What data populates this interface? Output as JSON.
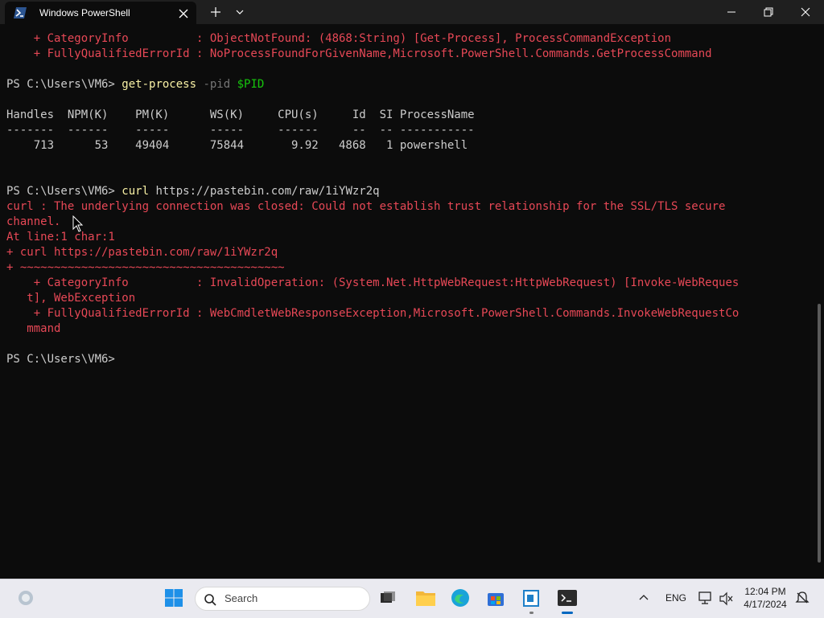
{
  "window": {
    "tab_title": "Windows PowerShell"
  },
  "terminal": {
    "lines": {
      "l1": "    + CategoryInfo          : ObjectNotFound: (4868:String) [Get-Process], ProcessCommandException",
      "l2": "    + FullyQualifiedErrorId : NoProcessFoundForGivenName,Microsoft.PowerShell.Commands.GetProcessCommand",
      "prompt1": "PS C:\\Users\\VM6> ",
      "cmd1": "get-process",
      "param1": " -pid ",
      "var1": "$PID",
      "header": "Handles  NPM(K)    PM(K)      WS(K)     CPU(s)     Id  SI ProcessName",
      "dashes": "-------  ------    -----      -----     ------     --  -- -----------",
      "row": "    713      53    49404      75844       9.92   4868   1 powershell",
      "prompt2": "PS C:\\Users\\VM6> ",
      "cmd2": "curl",
      "arg2": " https://pastebin.com/raw/1iYWzr2q",
      "e1": "curl : The underlying connection was closed: Could not establish trust relationship for the SSL/TLS secure",
      "e2": "channel.",
      "e3": "At line:1 char:1",
      "e4": "+ curl https://pastebin.com/raw/1iYWzr2q",
      "e5": "+ ~~~~~~~~~~~~~~~~~~~~~~~~~~~~~~~~~~~~~~~",
      "e6": "    + CategoryInfo          : InvalidOperation: (System.Net.HttpWebRequest:HttpWebRequest) [Invoke-WebReques",
      "e7": "   t], WebException",
      "e8": "    + FullyQualifiedErrorId : WebCmdletWebResponseException,Microsoft.PowerShell.Commands.InvokeWebRequestCo",
      "e9": "   mmand",
      "prompt3": "PS C:\\Users\\VM6>"
    }
  },
  "taskbar": {
    "search_placeholder": "Search",
    "language": "ENG",
    "time": "12:04 PM",
    "date": "4/17/2024"
  },
  "icons": {
    "tab": "powershell-icon",
    "start": "windows-start-icon",
    "search": "search-icon",
    "apps": [
      "task-view-icon",
      "file-explorer-icon",
      "edge-icon",
      "store-icon",
      "notepad-icon",
      "terminal-icon"
    ]
  },
  "colors": {
    "error": "#e74856",
    "command": "#f9f1a5",
    "variable": "#16c60c",
    "parameter": "#767676"
  }
}
